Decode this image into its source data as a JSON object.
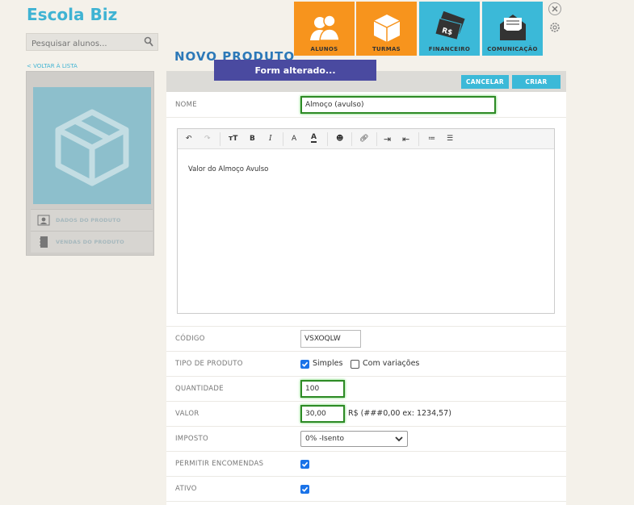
{
  "app": {
    "title": "Escola Biz"
  },
  "search": {
    "placeholder": "Pesquisar alunos..."
  },
  "nav": [
    {
      "label": "ALUNOS",
      "icon": "students-icon",
      "color": "#f7941d"
    },
    {
      "label": "TURMAS",
      "icon": "box-icon",
      "color": "#f7941d"
    },
    {
      "label": "FINANCEIRO",
      "icon": "money-icon",
      "color": "#3bb9d8"
    },
    {
      "label": "COMUNICAÇÃO",
      "icon": "envelope-icon",
      "color": "#3bb9d8"
    }
  ],
  "back_link": "< VOLTAR À LISTA",
  "page_title": "NOVO PRODUTO",
  "toast": "Form alterado...",
  "sidebar": {
    "items": [
      {
        "label": "DADOS DO PRODUTO",
        "icon": "id-card-icon"
      },
      {
        "label": "VENDAS DO PRODUTO",
        "icon": "notebook-icon"
      }
    ]
  },
  "actions": {
    "cancel": "CANCELAR",
    "create": "CRIAR"
  },
  "form": {
    "nome": {
      "label": "NOME",
      "value": "Almoço (avulso)"
    },
    "descricao": {
      "content": "Valor do Almoço Avulso"
    },
    "codigo": {
      "label": "CÓDIGO",
      "value": "VSXOQLW"
    },
    "tipo": {
      "label": "TIPO DE PRODUTO",
      "option_simples": "Simples",
      "option_variacoes": "Com variações",
      "simples_checked": true,
      "variacoes_checked": false
    },
    "quantidade": {
      "label": "QUANTIDADE",
      "value": "100"
    },
    "valor": {
      "label": "VALOR",
      "value": "30,00",
      "hint": "R$ (###0,00 ex: 1234,57)"
    },
    "imposto": {
      "label": "IMPOSTO",
      "selected": "0% -Isento"
    },
    "encomendas": {
      "label": "PERMITIR ENCOMENDAS",
      "checked": true
    },
    "ativo": {
      "label": "ATIVO",
      "checked": true
    }
  },
  "colors": {
    "accent": "#3bb9d8",
    "brand": "#3fb3d3",
    "orange": "#f7941d",
    "toast": "#4a4aa0",
    "focus": "#2d8a25"
  }
}
